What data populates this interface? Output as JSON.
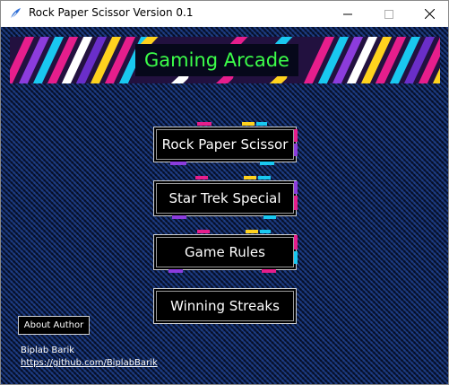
{
  "window": {
    "title": "Rock Paper Scissor Version 0.1",
    "controls": {
      "minimize": "minimize-icon",
      "maximize": "maximize-icon",
      "close": "close-icon"
    }
  },
  "banner": {
    "title": "Gaming Arcade",
    "title_color": "#3cff4a"
  },
  "menu": {
    "buttons": [
      {
        "label": "Rock Paper Scissor"
      },
      {
        "label": "Star Trek Special"
      },
      {
        "label": "Game Rules"
      },
      {
        "label": "Winning Streaks"
      }
    ]
  },
  "footer": {
    "about_label": "About Author",
    "author_name": "Biplab Barik",
    "author_url": "https://github.com/BiplabBarik"
  },
  "colors": {
    "background": "#0b1a3e",
    "accent_pink": "#e61e8c",
    "accent_cyan": "#19c8f0",
    "accent_yellow": "#ffd21e",
    "accent_purple": "#8c3cdc"
  }
}
